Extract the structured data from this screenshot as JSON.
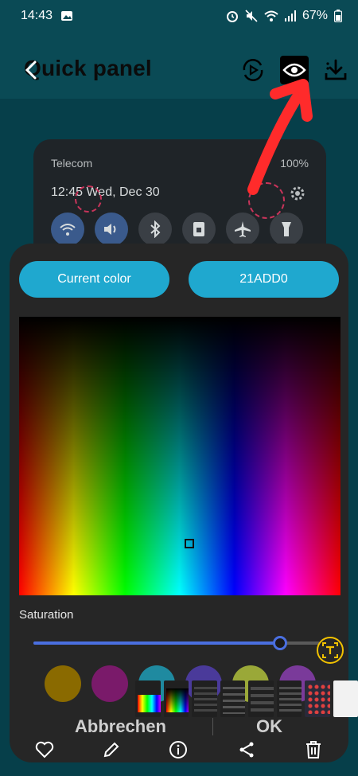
{
  "status_bar": {
    "time": "14:43",
    "battery": "67%"
  },
  "header": {
    "title": "Quick panel"
  },
  "preview": {
    "carrier": "Telecom",
    "battery": "100%",
    "time_date": "12:45  Wed, Dec 30"
  },
  "picker": {
    "current_color_label": "Current color",
    "hex_value": "21ADD0",
    "saturation_label": "Saturation",
    "saturation_value": 0.86,
    "swatches": [
      "#8a6a00",
      "#7a1a6a",
      "#1f8aa0",
      "#4a3a9a",
      "#9aa838",
      "#7a3a9a"
    ]
  },
  "actions": {
    "cancel_label": "Abbrechen",
    "ok_label": "OK"
  },
  "colors": {
    "accent": "#1fa8cf",
    "annotation_red": "#ff2b2b",
    "slider_blue": "#4a6fe0"
  }
}
